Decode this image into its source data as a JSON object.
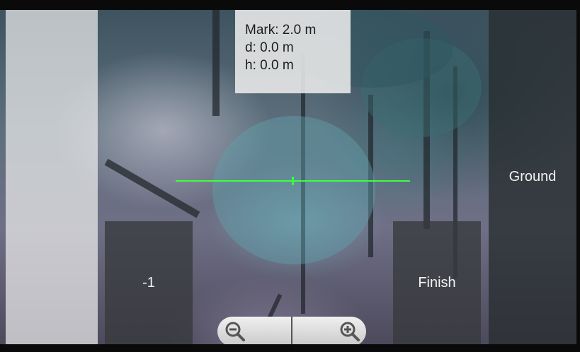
{
  "measurement": {
    "mark": "Mark: 2.0 m",
    "distance": "d: 0.0 m",
    "height": "h: 0.0 m"
  },
  "buttons": {
    "minus_label": "-1",
    "finish_label": "Finish",
    "ground_label": "Ground"
  },
  "zoom": {
    "out_icon": "zoom-out-icon",
    "in_icon": "zoom-in-icon"
  },
  "colors": {
    "crosshair": "#3dff3d"
  }
}
